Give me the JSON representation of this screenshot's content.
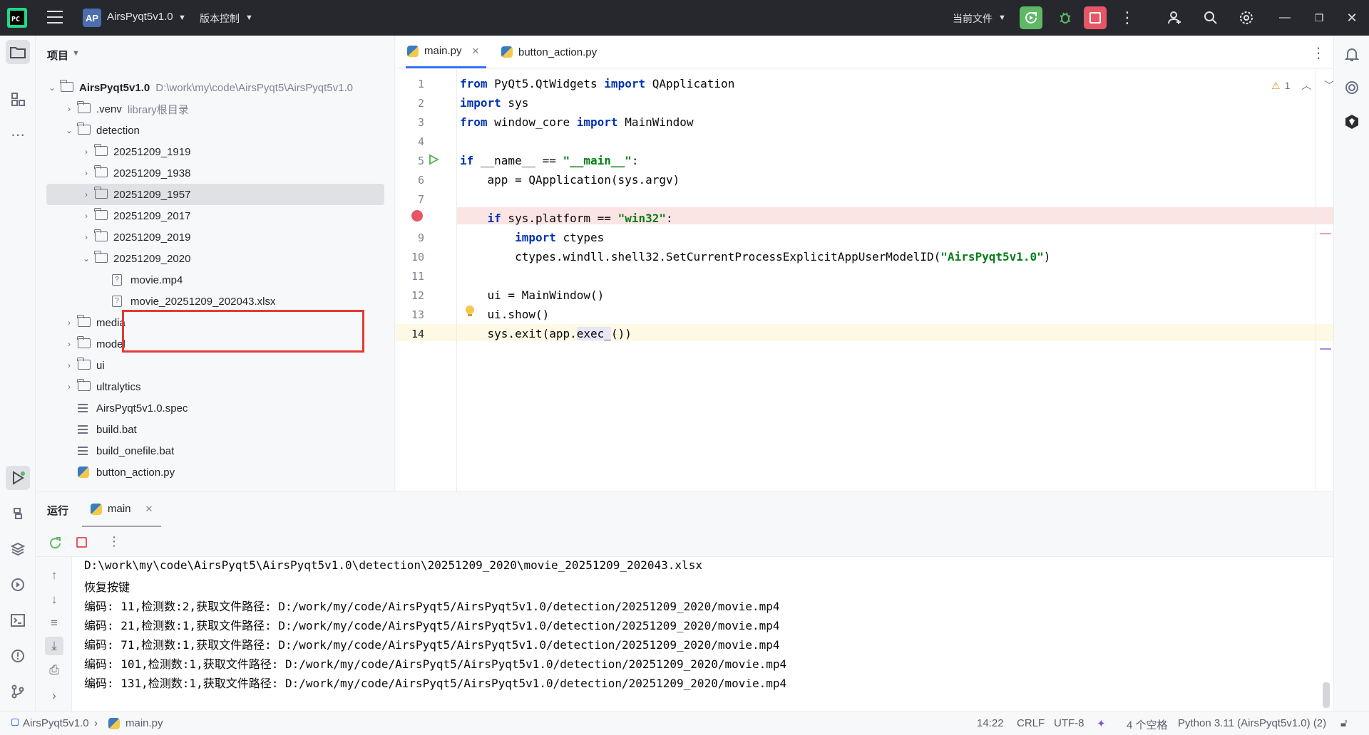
{
  "titlebar": {
    "project_badge": "AP",
    "project_name": "AirsPyqt5v1.0",
    "vcs_label": "版本控制",
    "run_config": "当前文件"
  },
  "project_panel": {
    "title": "项目",
    "root_name": "AirsPyqt5v1.0",
    "root_path": "D:\\work\\my\\code\\AirsPyqt5\\AirsPyqt5v1.0",
    "items": [
      {
        "label": ".venv",
        "hint": "library根目录",
        "type": "folder",
        "level": 1
      },
      {
        "label": "detection",
        "hint": "",
        "type": "folder",
        "level": 1
      },
      {
        "label": "20251209_1919",
        "hint": "",
        "type": "folder",
        "level": 2
      },
      {
        "label": "20251209_1938",
        "hint": "",
        "type": "folder",
        "level": 2
      },
      {
        "label": "20251209_1957",
        "hint": "",
        "type": "folder",
        "level": 2
      },
      {
        "label": "20251209_2017",
        "hint": "",
        "type": "folder",
        "level": 2
      },
      {
        "label": "20251209_2019",
        "hint": "",
        "type": "folder",
        "level": 2
      },
      {
        "label": "20251209_2020",
        "hint": "",
        "type": "folder",
        "level": 2
      },
      {
        "label": "movie.mp4",
        "hint": "",
        "type": "unknown-file",
        "level": 3
      },
      {
        "label": "movie_20251209_202043.xlsx",
        "hint": "",
        "type": "unknown-file",
        "level": 3
      },
      {
        "label": "media",
        "hint": "",
        "type": "folder",
        "level": 1
      },
      {
        "label": "model",
        "hint": "",
        "type": "folder",
        "level": 1
      },
      {
        "label": "ui",
        "hint": "",
        "type": "folder",
        "level": 1
      },
      {
        "label": "ultralytics",
        "hint": "",
        "type": "folder",
        "level": 1
      },
      {
        "label": "AirsPyqt5v1.0.spec",
        "hint": "",
        "type": "text-file",
        "level": 1
      },
      {
        "label": "build.bat",
        "hint": "",
        "type": "text-file",
        "level": 1
      },
      {
        "label": "build_onefile.bat",
        "hint": "",
        "type": "text-file",
        "level": 1
      },
      {
        "label": "button_action.py",
        "hint": "",
        "type": "python-file",
        "level": 1
      }
    ]
  },
  "editor": {
    "tabs": [
      {
        "label": "main.py",
        "active": true
      },
      {
        "label": "button_action.py",
        "active": false
      }
    ],
    "warning_count": "1",
    "line_numbers": [
      "1",
      "2",
      "3",
      "4",
      "5",
      "6",
      "7",
      "9",
      "10",
      "11",
      "12",
      "13",
      "14"
    ]
  },
  "run_panel": {
    "title": "运行",
    "tab_label": "main",
    "console_lines": [
      "D:\\work\\my\\code\\AirsPyqt5\\AirsPyqt5v1.0\\detection\\20251209_2020\\movie_20251209_202043.xlsx",
      "恢复按键",
      "编码: 11,检测数:2,获取文件路径: D:/work/my/code/AirsPyqt5/AirsPyqt5v1.0/detection/20251209_2020/movie.mp4",
      "编码: 21,检测数:1,获取文件路径: D:/work/my/code/AirsPyqt5/AirsPyqt5v1.0/detection/20251209_2020/movie.mp4",
      "编码: 71,检测数:1,获取文件路径: D:/work/my/code/AirsPyqt5/AirsPyqt5v1.0/detection/20251209_2020/movie.mp4",
      "编码: 101,检测数:1,获取文件路径: D:/work/my/code/AirsPyqt5/AirsPyqt5v1.0/detection/20251209_2020/movie.mp4",
      "编码: 131,检测数:1,获取文件路径: D:/work/my/code/AirsPyqt5/AirsPyqt5v1.0/detection/20251209_2020/movie.mp4"
    ]
  },
  "statusbar": {
    "breadcrumb_project": "AirsPyqt5v1.0",
    "breadcrumb_file": "main.py",
    "position": "14:22",
    "line_sep": "CRLF",
    "encoding": "UTF-8",
    "indent": "4 个空格",
    "interpreter": "Python 3.11 (AirsPyqt5v1.0) (2)"
  },
  "colors": {
    "accent": "#3574f0",
    "run_green": "#5fb865",
    "stop_red": "#e55765",
    "highlight_box": "#e53935"
  }
}
